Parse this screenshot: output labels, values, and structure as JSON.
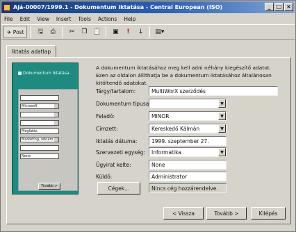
{
  "window": {
    "title": "Ajá-00007/1999.1 - Dokumentum iktatása - Central European (ISO)"
  },
  "menu": [
    "File",
    "Edit",
    "View",
    "Insert",
    "Tools",
    "Actions",
    "Help"
  ],
  "toolbar": {
    "post_label": "Post",
    "icons": [
      "save-icon",
      "print-icon",
      "cut-icon",
      "copy-icon",
      "paste-icon",
      "attach-icon",
      "importance-high-icon",
      "importance-low-icon",
      "options-icon"
    ]
  },
  "tab": {
    "label": "Iktatás adatlap"
  },
  "picture": {
    "title": "Dokumentum iktatása",
    "fields": [
      "",
      "Microsoft",
      "",
      "",
      "Meglátás",
      "Marketing, reklám",
      "",
      "None"
    ],
    "button": "Tovább >"
  },
  "description": "A dokumentum iktatásához meg kell adni néhány kiegészítő adatot. Ezen az oldalon állíthatja be a dokumentum iktatásához általánosan kitöltendő adatokat.",
  "form": {
    "targy": {
      "label": "Tárgy/tartalom:",
      "value": "MultiWorX szerződés"
    },
    "tipus": {
      "label": "Dokumentum típusa:",
      "value": ""
    },
    "felado": {
      "label": "Feladó:",
      "value": "MINOR"
    },
    "cimzett": {
      "label": "Címzett:",
      "value": "Kereskedő Kálmán"
    },
    "datum": {
      "label": "Iktatás dátuma:",
      "value": "1999. szeptember 27."
    },
    "egyseg": {
      "label": "Szervezeti egység:",
      "value": "Informatika"
    },
    "kelte": {
      "label": "Ügyirat kelte:",
      "value": "None"
    },
    "kuldo": {
      "label": "Küldő:",
      "value": "Administrator"
    },
    "cegek_button": "Cégek...",
    "cegek_value": "Nincs cég hozzárendelve."
  },
  "nav": {
    "back": "< Vissza",
    "next": "Tovább >",
    "exit": "Kilépés"
  }
}
